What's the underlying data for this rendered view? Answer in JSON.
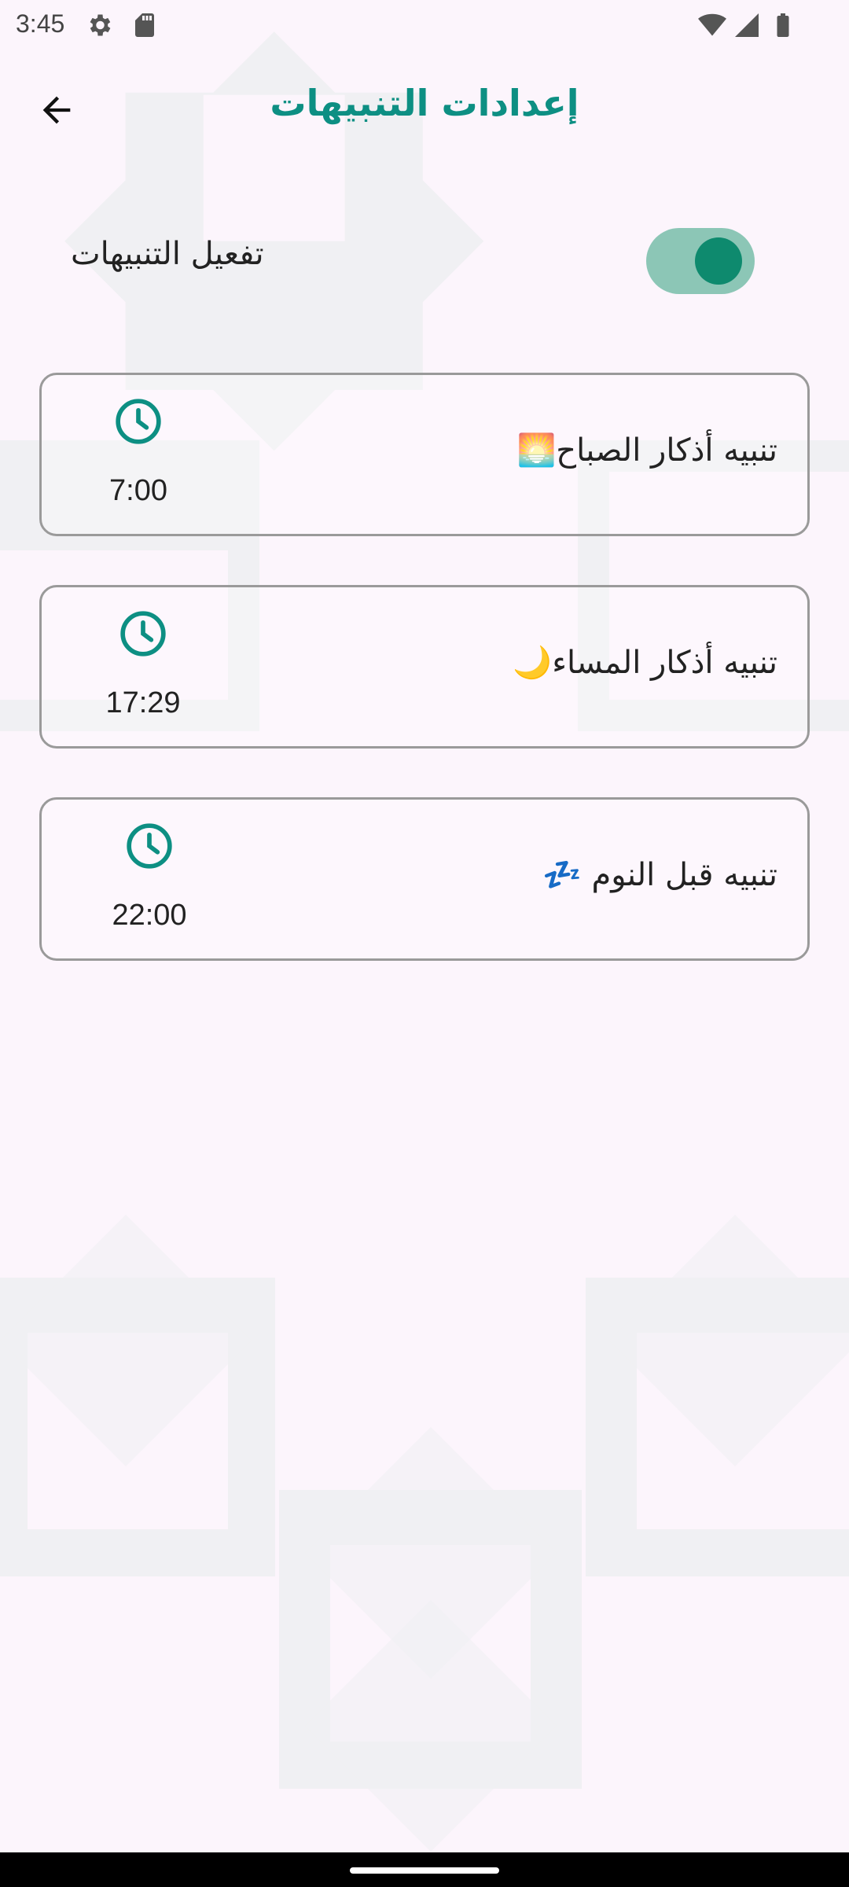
{
  "status_bar": {
    "time": "3:45",
    "icons": [
      "settings-icon",
      "sd-card-icon",
      "wifi-icon",
      "signal-icon",
      "battery-icon"
    ]
  },
  "app_bar": {
    "title": "إعدادات التنبيهات",
    "back_icon": "arrow-back-icon"
  },
  "notifications_toggle": {
    "label": "تفعيل التنبيهات",
    "enabled": true
  },
  "alarms": [
    {
      "title": "تنبيه أذكار الصباح🌅",
      "time": "7:00",
      "icon": "clock-icon"
    },
    {
      "title": "تنبيه أذكار المساء🌙",
      "time": "17:29",
      "icon": "clock-icon"
    },
    {
      "title": "تنبيه قبل النوم 💤",
      "time": "22:00",
      "icon": "clock-icon"
    }
  ],
  "colors": {
    "accent": "#0d8f83",
    "switch_track": "#8cc6b6",
    "switch_thumb": "#0e8a6e",
    "background": "#fcf5fc",
    "card_border": "#9a9a9a"
  }
}
